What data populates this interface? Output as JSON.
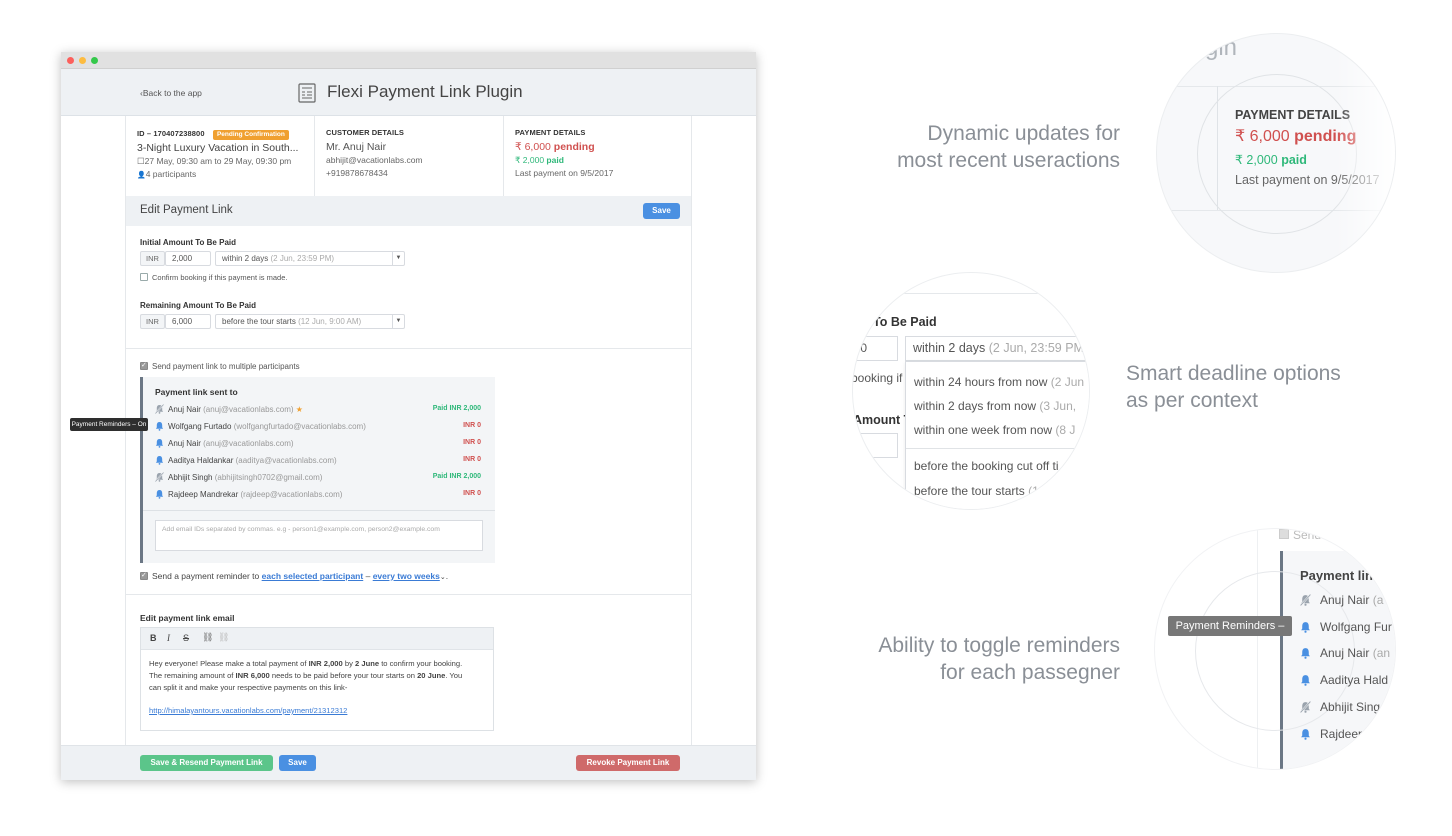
{
  "app": {
    "title": "Flexi Payment Link Plugin",
    "back_label": "Back to the app"
  },
  "booking": {
    "id": "ID – 170407238800",
    "status": "Pending Confirmation",
    "title": "3-Night Luxury Vacation in South...",
    "dates": "27 May, 09:30 am to 29 May, 09:30 pm",
    "participants": "4 participants"
  },
  "customer": {
    "heading": "CUSTOMER DETAILS",
    "name": "Mr. Anuj Nair",
    "email": "abhijit@vacationlabs.com",
    "phone": "+919878678434"
  },
  "payment": {
    "heading": "PAYMENT DETAILS",
    "pending": "₹ 6,000",
    "pending_word": "pending",
    "paid": "₹ 2,000",
    "paid_word": "paid",
    "last": "Last payment on 9/5/2017"
  },
  "edit": {
    "title": "Edit Payment Link",
    "save": "Save",
    "initial_label": "Initial Amount To Be Paid",
    "initial_currency": "INR",
    "initial_amount": "2,000",
    "initial_deadline": "within 2 days",
    "initial_deadline_hint": "(2 Jun, 23:59 PM)",
    "confirm_label": "Confirm booking if this payment is made.",
    "remaining_label": "Remaining Amount To Be Paid",
    "remaining_currency": "INR",
    "remaining_amount": "6,000",
    "remaining_deadline": "before the tour starts",
    "remaining_deadline_hint": "(12 Jun, 9:00 AM)",
    "multi_label": "Send payment link to multiple participants",
    "sent_title": "Payment link sent to",
    "email_placeholder": "Add email IDs separated by commas. e.g - person1@example.com, person2@example.com",
    "reminder_prefix": "Send a payment reminder to",
    "reminder_who": "each selected participant",
    "reminder_dash": "–",
    "reminder_freq": "every two weeks",
    "reminder_end": ".",
    "tooltip": "Payment Reminders – On",
    "email_section": "Edit payment link email",
    "email_line1a": "Hey everyone! Please make a total payment of ",
    "email_line1b": "INR 2,000",
    "email_line1c": " by ",
    "email_line1d": "2 June",
    "email_line1e": " to confirm your booking.",
    "email_line2a": "The remaining amount of ",
    "email_line2b": "INR 6,000",
    "email_line2c": " needs to be paid before your tour starts on ",
    "email_line2d": "20 June",
    "email_line2e": ". You",
    "email_line3": "can split it and make your respective payments on this link-",
    "email_link": "http://himalayantours.vacationlabs.com/payment/21312312"
  },
  "participants": [
    {
      "name": "Anuj Nair",
      "email": "(anuj@vacationlabs.com)",
      "amount": "Paid INR 2,000",
      "reminder": false,
      "star": true
    },
    {
      "name": "Wolfgang Furtado",
      "email": "(wolfgangfurtado@vacationlabs.com)",
      "amount": "INR 0",
      "reminder": true
    },
    {
      "name": "Anuj Nair",
      "email": "(anuj@vacationlabs.com)",
      "amount": "INR 0",
      "reminder": true
    },
    {
      "name": "Aaditya Haldankar",
      "email": "(aaditya@vacationlabs.com)",
      "amount": "INR 0",
      "reminder": true
    },
    {
      "name": "Abhijit Singh",
      "email": "(abhijitsingh0702@gmail.com)",
      "amount": "Paid INR 2,000",
      "reminder": false
    },
    {
      "name": "Rajdeep Mandrekar",
      "email": "(rajdeep@vacationlabs.com)",
      "amount": "INR 0",
      "reminder": true
    }
  ],
  "footer": {
    "resend": "Save & Resend Payment Link",
    "save": "Save",
    "revoke": "Revoke Payment Link"
  },
  "features": {
    "f1_line1": "Dynamic updates for",
    "f1_line2": "most recent useractions",
    "f2_line1": "Smart deadline options",
    "f2_line2": "as per context",
    "f3_line1": "Ability to toggle reminders",
    "f3_line2": "for each passegner"
  },
  "zoom1": {
    "partial_title": "gin",
    "heading": "PAYMENT DETAILS",
    "pending": "₹ 6,000",
    "pending_word": "pending",
    "paid": "₹ 2,000",
    "paid_word": "paid",
    "last": "Last payment on 9/5/2017"
  },
  "zoom2": {
    "label": "To Be Paid",
    "amount": "0",
    "selected": "within 2 days",
    "selected_hint": "(2 Jun, 23:59 PM",
    "side1": "booking if",
    "side2": "Amount T",
    "opt1": "within 24 hours from now",
    "opt1_hint": "(2 Jun",
    "opt2": "within 2 days from now",
    "opt2_hint": "(3 Jun,",
    "opt3": "within one week from now",
    "opt3_hint": "(8 J",
    "opt4": "before the booking cut off ti",
    "opt5": "before the tour starts",
    "opt5_hint": "(1"
  },
  "zoom3": {
    "send": "Send",
    "title": "Payment lin",
    "tooltip": "Payment Reminders – On",
    "rows": [
      {
        "name": "Anuj Nair",
        "hint": "(a",
        "reminder": false
      },
      {
        "name": "Wolfgang Fur",
        "hint": "",
        "reminder": true
      },
      {
        "name": "Anuj Nair",
        "hint": "(an",
        "reminder": true
      },
      {
        "name": "Aaditya Hald",
        "hint": "",
        "reminder": true
      },
      {
        "name": "Abhijit Sing",
        "hint": "",
        "reminder": false
      },
      {
        "name": "Rajdeep",
        "hint": "",
        "reminder": true
      }
    ]
  },
  "colors": {
    "pending": "#d0504f",
    "paid": "#2fb87a",
    "primary": "#4a90e2",
    "success": "#5bc58a",
    "danger": "#cf6a6a",
    "badge": "#f0a030"
  }
}
